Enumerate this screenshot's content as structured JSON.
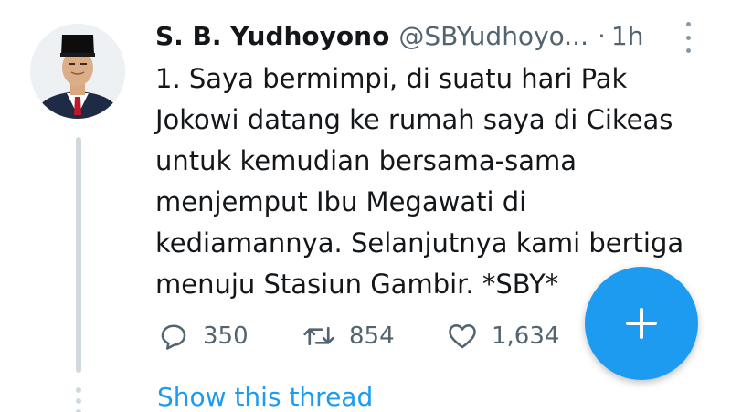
{
  "tweet": {
    "display_name": "S. B. Yudhoyono",
    "handle": "@SBYudhoyo...",
    "separator": "·",
    "time": "1h",
    "text_lines": [
      "1. Saya bermimpi, di suatu hari Pak",
      "Jokowi datang ke rumah saya di Cikeas",
      "untuk kemudian bersama-sama",
      "menjemput Ibu Megawati di",
      "kediamannya. Selanjutnya kami bertiga",
      "menuju Stasiun Gambir. *SBY*"
    ],
    "actions": {
      "reply_count": "350",
      "retweet_count": "854",
      "like_count": "1,634"
    },
    "show_thread": "Show this thread"
  },
  "icons": {
    "reply": "speech-bubble-icon",
    "retweet": "retweet-arrows-icon",
    "like": "heart-icon",
    "more": "vertical-dots-icon",
    "compose": "plus-icon"
  },
  "colors": {
    "accent": "#1d9bf0",
    "secondary_text": "#536471",
    "thread_line": "#cfd9de"
  }
}
